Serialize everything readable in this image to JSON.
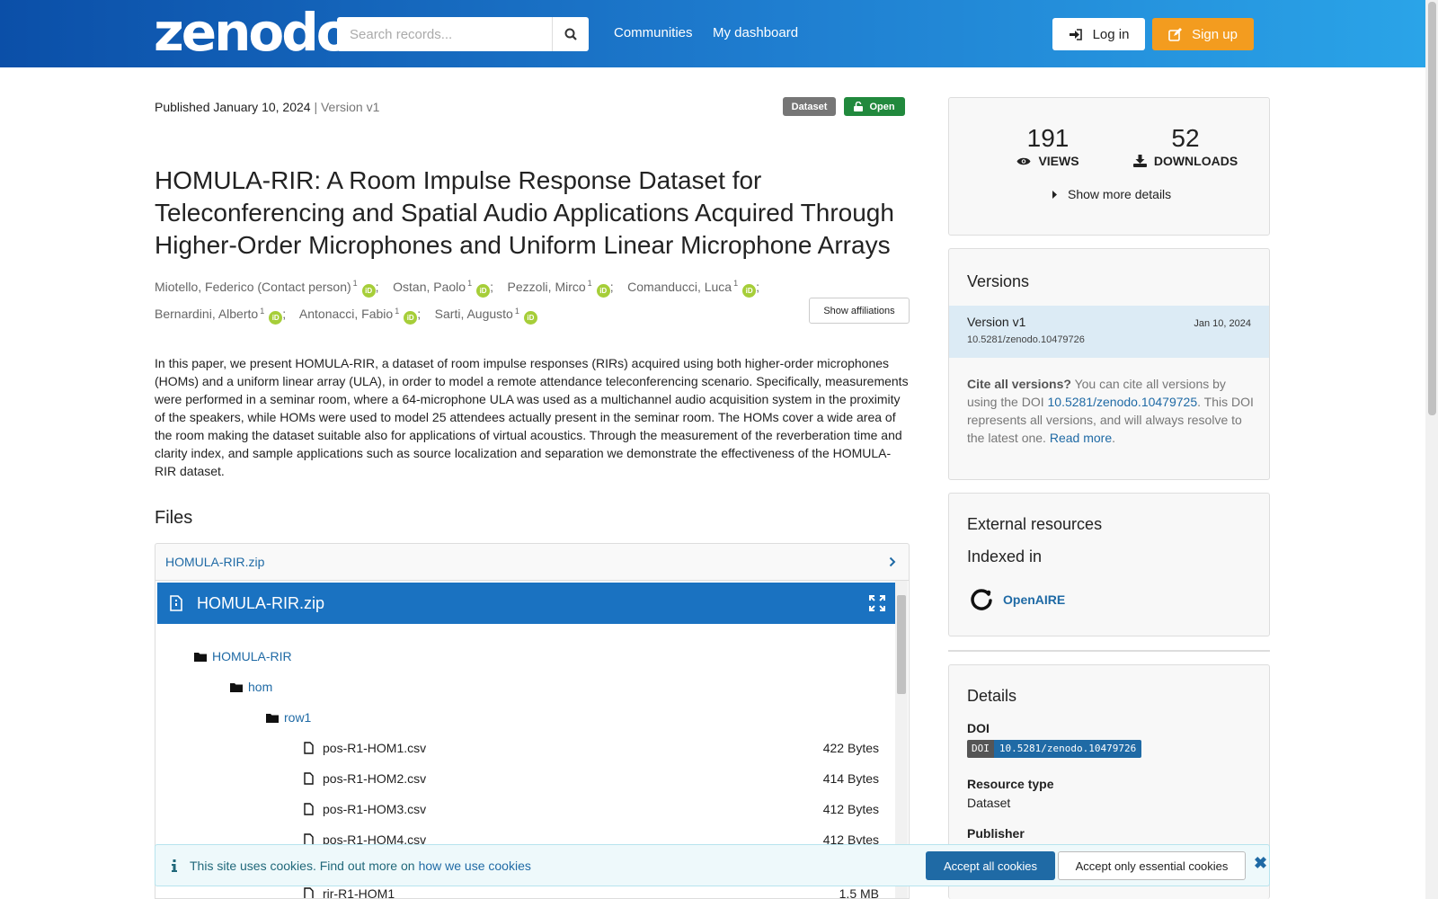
{
  "header": {
    "logo": "zenodo",
    "search_placeholder": "Search records...",
    "nav": [
      "Communities",
      "My dashboard"
    ],
    "login_label": "Log in",
    "signup_label": "Sign up"
  },
  "record": {
    "published": "Published January 10, 2024",
    "version": "| Version v1",
    "badge_type": "Dataset",
    "badge_access": "Open",
    "title": "HOMULA-RIR: A Room Impulse Response Dataset for Teleconferencing and Spatial Audio Applications Acquired Through Higher-Order Microphones and Uniform Linear Microphone Arrays",
    "authors": [
      {
        "name": "Miotello, Federico (Contact person)",
        "aff": "1"
      },
      {
        "name": "Ostan, Paolo",
        "aff": "1"
      },
      {
        "name": "Pezzoli, Mirco",
        "aff": "1"
      },
      {
        "name": "Comanducci, Luca",
        "aff": "1"
      },
      {
        "name": "Bernardini, Alberto",
        "aff": "1"
      },
      {
        "name": "Antonacci, Fabio",
        "aff": "1"
      },
      {
        "name": "Sarti, Augusto",
        "aff": "1"
      }
    ],
    "orcid_label": "iD",
    "show_affiliations": "Show affiliations",
    "abstract": "In this paper, we present HOMULA-RIR, a dataset of room impulse responses (RIRs) acquired using both higher-order microphones (HOMs) and a uniform linear array (ULA), in order to model a remote attendance teleconferencing scenario. Specifically, measurements were performed in a seminar room, where a 64-microphone ULA was used as a multichannel audio acquisition system in the proximity of the speakers, while HOMs were used to model 25 attendees actually present in the seminar room. The HOMs cover a wide area of the room making the dataset suitable also for applications of virtual acoustics. Through the measurement of the reverberation time and clarity index, and sample applications such as source localization and separation we demonstrate the effectiveness of the HOMULA-RIR dataset."
  },
  "files": {
    "heading": "Files",
    "archive": "HOMULA-RIR.zip",
    "preview_title": "HOMULA-RIR.zip",
    "tree": {
      "root": "HOMULA-RIR",
      "sub": "hom",
      "subsub": "row1",
      "items": [
        {
          "name": "pos-R1-HOM1.csv",
          "size": "422 Bytes"
        },
        {
          "name": "pos-R1-HOM2.csv",
          "size": "414 Bytes"
        },
        {
          "name": "pos-R1-HOM3.csv",
          "size": "412 Bytes"
        },
        {
          "name": "pos-R1-HOM4.csv",
          "size": "412 Bytes"
        },
        {
          "name": "rir-R1-HOM1",
          "size": "1.5 MB"
        }
      ]
    }
  },
  "stats": {
    "views": "191",
    "views_label": "VIEWS",
    "downloads": "52",
    "downloads_label": "DOWNLOADS",
    "more": "Show more details"
  },
  "versions": {
    "heading": "Versions",
    "current": "Version v1",
    "date": "Jan 10, 2024",
    "doi": "10.5281/zenodo.10479726",
    "cite_bold": "Cite all versions?",
    "cite_text1": " You can cite all versions by using the DOI ",
    "cite_doi": "10.5281/zenodo.10479725",
    "cite_text2": ". This DOI represents all versions, and will always resolve to the latest one. ",
    "read_more": "Read more",
    "period": "."
  },
  "external": {
    "heading": "External resources",
    "sub": "Indexed in",
    "openaire": "OpenAIRE"
  },
  "details": {
    "heading": "Details",
    "doi_label": "DOI",
    "doi_tag": "DOI",
    "doi_value": "10.5281/zenodo.10479726",
    "type_label": "Resource type",
    "type_value": "Dataset",
    "publisher_label": "Publisher"
  },
  "cookie": {
    "text": "This site uses cookies. Find out more on",
    "link": "how we use cookies",
    "accept": "Accept all cookies",
    "essential": "Accept only essential cookies"
  },
  "colors": {
    "accent": "#1f6aa5",
    "signup": "#f39c1f",
    "open": "#21893d",
    "header_start": "#0b4fa8",
    "header_end": "#2aa4e8"
  }
}
